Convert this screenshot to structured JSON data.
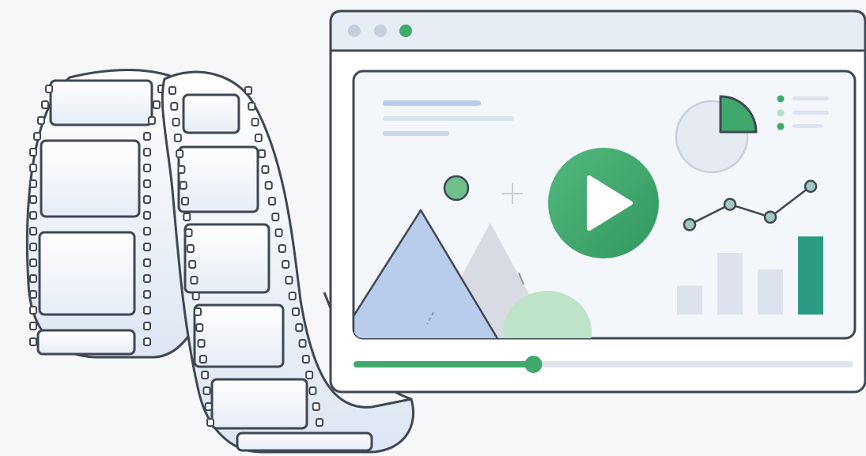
{
  "player": {
    "progress": 0.36
  },
  "icons": {
    "film": "film-strip-icon",
    "play": "play-icon",
    "pie": "pie-chart-icon",
    "line": "line-chart-icon",
    "image": "image-icon"
  },
  "colors": {
    "background": "#f6f7f9",
    "window_outline": "#3f4654",
    "title_bar": "#e7edf5",
    "accent_green": "#3ea96b",
    "accent_teal": "#2c9b84",
    "light_blue": "#b9ccec",
    "gray": "#d7dbe4",
    "bar_inactive": "#dde3ee",
    "film_fill": "#e9eef6"
  },
  "chart_data": {
    "type": "bar",
    "categories": [
      "",
      "",
      "",
      ""
    ],
    "values": [
      0.35,
      0.75,
      0.55,
      0.95
    ],
    "title": "",
    "xlabel": "",
    "ylabel": "",
    "ylim": [
      0,
      1
    ],
    "line": [
      0.45,
      0.72,
      0.55,
      0.96
    ]
  }
}
